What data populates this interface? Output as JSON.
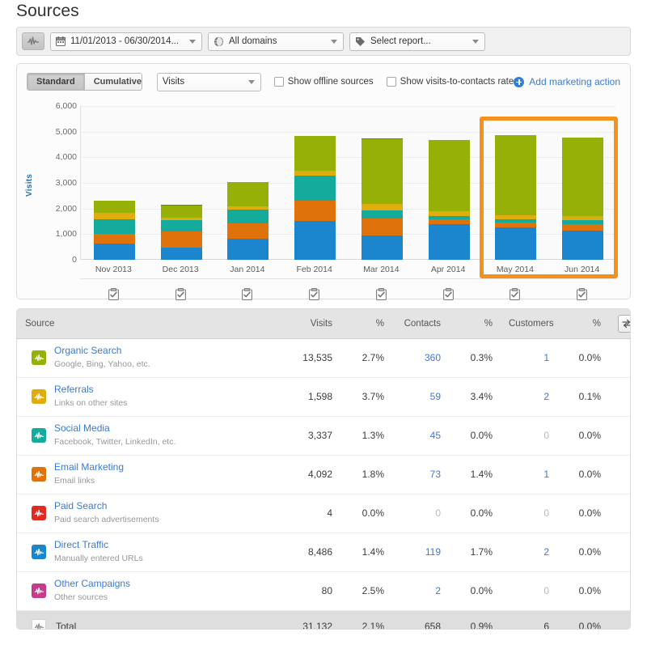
{
  "page_title": "Sources",
  "toolbar": {
    "pulse_icon": "activity-pulse-icon",
    "date_range": "11/01/2013 - 06/30/2014...",
    "date_icon": "calendar-icon",
    "domain": "All domains",
    "domain_icon": "globe-icon",
    "report": "Select report...",
    "report_icon": "tag-icon"
  },
  "chart_controls": {
    "standard_label": "Standard",
    "cumulative_label": "Cumulative",
    "active_mode": "Standard",
    "metric": "Visits",
    "show_offline_label": "Show offline sources",
    "show_offline_checked": false,
    "show_vtc_label": "Show visits-to-contacts rate",
    "show_vtc_checked": false,
    "add_action_label": "Add marketing action",
    "add_action_color": "#3a7bd5"
  },
  "chart_data": {
    "type": "bar",
    "stacked": true,
    "title": "",
    "xlabel": "",
    "ylabel": "Visits",
    "ylim": [
      0,
      6000
    ],
    "yticks": [
      0,
      1000,
      2000,
      3000,
      4000,
      5000,
      6000
    ],
    "ytick_labels": [
      "0",
      "1,000",
      "2,000",
      "3,000",
      "4,000",
      "5,000",
      "6,000"
    ],
    "grid": true,
    "legend": "none",
    "categories": [
      "Nov 2013",
      "Dec 2013",
      "Jan 2014",
      "Feb 2014",
      "Mar 2014",
      "Apr 2014",
      "May 2014",
      "Jun 2014"
    ],
    "series": [
      {
        "name": "Direct Traffic",
        "color": "#1b86ce",
        "values": [
          620,
          480,
          820,
          1530,
          960,
          1380,
          1250,
          1150
        ]
      },
      {
        "name": "Email Marketing",
        "color": "#e0720c",
        "values": [
          400,
          620,
          600,
          780,
          640,
          200,
          210,
          230
        ]
      },
      {
        "name": "Social Media",
        "color": "#14ab9c",
        "values": [
          560,
          450,
          550,
          970,
          320,
          120,
          110,
          180
        ]
      },
      {
        "name": "Referrals",
        "color": "#e0ad0f",
        "values": [
          250,
          100,
          110,
          210,
          240,
          190,
          180,
          160
        ]
      },
      {
        "name": "Organic Search",
        "color": "#97b008",
        "values": [
          470,
          470,
          950,
          1350,
          2530,
          2770,
          3120,
          3050
        ]
      },
      {
        "name": "Other Campaigns",
        "color": "#c63b8c",
        "values": [
          0,
          35,
          0,
          0,
          35,
          0,
          0,
          0
        ]
      }
    ],
    "totals": [
      2300,
      2125,
      3030,
      4840,
      4725,
      4660,
      4870,
      4770
    ],
    "highlight": {
      "from": "May 2014",
      "to": "Jun 2014",
      "color": "#f5911e"
    },
    "month_marker_icon": "clipboard-check-icon"
  },
  "table": {
    "columns": [
      "Source",
      "Visits",
      "%",
      "Contacts",
      "%",
      "Customers",
      "%"
    ],
    "swap_icon": "swap-columns-icon",
    "rows": [
      {
        "icon": "activity-pulse-icon",
        "color": "#97b008",
        "name": "Organic Search",
        "desc": "Google, Bing, Yahoo, etc.",
        "visits": "13,535",
        "visits_pct": "2.7%",
        "contacts": "360",
        "contacts_link": true,
        "contacts_pct": "0.3%",
        "customers": "1",
        "customers_link": true,
        "customers_pct": "0.0%"
      },
      {
        "icon": "activity-pulse-icon",
        "color": "#e0ad0f",
        "name": "Referrals",
        "desc": "Links on other sites",
        "visits": "1,598",
        "visits_pct": "3.7%",
        "contacts": "59",
        "contacts_link": true,
        "contacts_pct": "3.4%",
        "customers": "2",
        "customers_link": true,
        "customers_pct": "0.1%"
      },
      {
        "icon": "activity-pulse-icon",
        "color": "#14ab9c",
        "name": "Social Media",
        "desc": "Facebook, Twitter, LinkedIn, etc.",
        "visits": "3,337",
        "visits_pct": "1.3%",
        "contacts": "45",
        "contacts_link": true,
        "contacts_pct": "0.0%",
        "customers": "0",
        "customers_link": false,
        "customers_pct": "0.0%"
      },
      {
        "icon": "activity-pulse-icon",
        "color": "#e0720c",
        "name": "Email Marketing",
        "desc": "Email links",
        "visits": "4,092",
        "visits_pct": "1.8%",
        "contacts": "73",
        "contacts_link": true,
        "contacts_pct": "1.4%",
        "customers": "1",
        "customers_link": true,
        "customers_pct": "0.0%"
      },
      {
        "icon": "activity-pulse-icon",
        "color": "#e02b1e",
        "name": "Paid Search",
        "desc": "Paid search advertisements",
        "visits": "4",
        "visits_pct": "0.0%",
        "contacts": "0",
        "contacts_link": false,
        "contacts_pct": "0.0%",
        "customers": "0",
        "customers_link": false,
        "customers_pct": "0.0%"
      },
      {
        "icon": "activity-pulse-icon",
        "color": "#1b86ce",
        "name": "Direct Traffic",
        "desc": "Manually entered URLs",
        "visits": "8,486",
        "visits_pct": "1.4%",
        "contacts": "119",
        "contacts_link": true,
        "contacts_pct": "1.7%",
        "customers": "2",
        "customers_link": true,
        "customers_pct": "0.0%"
      },
      {
        "icon": "activity-pulse-icon",
        "color": "#c63b8c",
        "name": "Other Campaigns",
        "desc": "Other sources",
        "visits": "80",
        "visits_pct": "2.5%",
        "contacts": "2",
        "contacts_link": true,
        "contacts_pct": "0.0%",
        "customers": "0",
        "customers_link": false,
        "customers_pct": "0.0%"
      }
    ],
    "total": {
      "icon": "activity-pulse-icon",
      "label": "Total",
      "visits": "31,132",
      "visits_pct": "2.1%",
      "contacts": "658",
      "contacts_pct": "0.9%",
      "customers": "6",
      "customers_pct": "0.0%"
    }
  }
}
